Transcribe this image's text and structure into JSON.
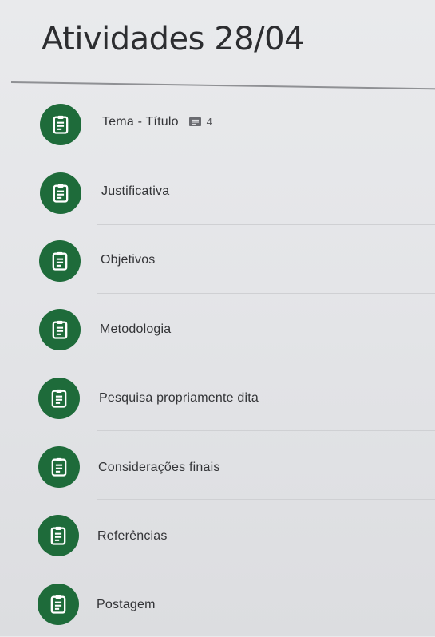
{
  "topic": {
    "title": "Atividades 28/04"
  },
  "items": [
    {
      "label": "Tema - Título",
      "icon": "assignment-icon",
      "comments": "4"
    },
    {
      "label": "Justificativa",
      "icon": "assignment-icon"
    },
    {
      "label": "Objetivos",
      "icon": "assignment-icon"
    },
    {
      "label": "Metodologia",
      "icon": "assignment-icon"
    },
    {
      "label": "Pesquisa propriamente dita",
      "icon": "assignment-icon"
    },
    {
      "label": "Considerações finais",
      "icon": "assignment-icon"
    },
    {
      "label": "Referências",
      "icon": "assignment-icon"
    },
    {
      "label": "Postagem",
      "icon": "assignment-icon"
    }
  ],
  "colors": {
    "icon_background": "#1e6b3a",
    "icon_foreground": "#ffffff",
    "background": "#e6e7ea"
  }
}
